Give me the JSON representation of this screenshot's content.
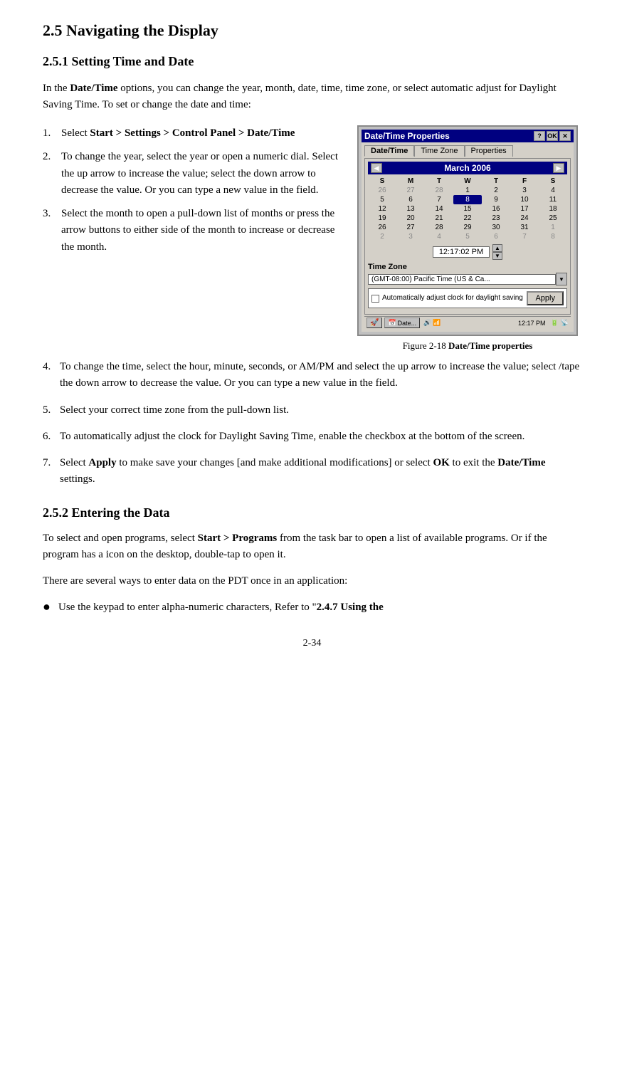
{
  "page": {
    "section_title": "2.5 Navigating the Display",
    "subsection_1_title": "2.5.1 Setting Time and Date",
    "subsection_2_title": "2.5.2 Entering the Data",
    "intro_text_1": "In the ",
    "intro_bold": "Date/Time",
    "intro_text_2": " options, you can change the year, month, date, time, time zone, or select automatic adjust for Daylight Saving Time. To set or change the date and time:",
    "steps": [
      {
        "num": "1.",
        "text": "Select ",
        "bold": "Start > Settings > Control Panel > Date/Time"
      },
      {
        "num": "2.",
        "text": "To change the year, select the year or open a numeric dial. Select the up arrow to increase the value; select the down arrow to decrease the value. Or you can type a new value in the field."
      },
      {
        "num": "3.",
        "text": "Select the month to open a pull-down list of months or press the arrow buttons to either side of the month to increase or decrease the month."
      }
    ],
    "para_steps": [
      {
        "num": "4.",
        "text": "To change the time, select the hour, minute, seconds, or AM/PM and select the up arrow to increase the value; select /tape the down arrow to decrease the value. Or you can type a new value in the field."
      },
      {
        "num": "5.",
        "text": "Select your correct time zone from the pull-down list."
      },
      {
        "num": "6.",
        "text": "To automatically adjust the clock for Daylight Saving Time, enable the checkbox at the bottom of the screen."
      },
      {
        "num": "7.",
        "text_before": "Select ",
        "bold1": "Apply",
        "text_mid": " to make save your changes [and make additional modifications] or select ",
        "bold2": "OK",
        "text_after": " to exit the ",
        "bold3": "Date/Time",
        "text_end": " settings."
      }
    ],
    "section2_para1_1": "To select and open programs, select ",
    "section2_bold1": "Start > Programs",
    "section2_para1_2": " from the task bar to open a list of available programs. Or if the program has a icon on the desktop, double-tap to open it.",
    "section2_para2": "There are several ways to enter data on the PDT once in an application:",
    "bullet_items": [
      {
        "text_before": "Use the keypad to enter alpha-numeric characters, Refer to “",
        "bold": "2.4.7 Using the"
      }
    ],
    "page_number": "2-34",
    "figure_caption_prefix": "Figure 2-18 ",
    "figure_caption_bold": "Date/Time properties",
    "device": {
      "titlebar": "Date/Time Properties",
      "titlebar_question": "?",
      "titlebar_ok": "OK",
      "titlebar_x": "✕",
      "tab1": "Date/Time",
      "tab2": "Time Zone",
      "tab3": "Properties",
      "cal_month_year": "March 2006",
      "cal_days_header": [
        "S",
        "M",
        "T",
        "W",
        "T",
        "F",
        "S"
      ],
      "cal_weeks": [
        [
          "26",
          "27",
          "28",
          "1",
          "2",
          "3",
          "4"
        ],
        [
          "5",
          "6",
          "7",
          "8",
          "9",
          "10",
          "11"
        ],
        [
          "12",
          "13",
          "14",
          "15",
          "16",
          "17",
          "18"
        ],
        [
          "19",
          "20",
          "21",
          "22",
          "23",
          "24",
          "25"
        ],
        [
          "26",
          "27",
          "28",
          "29",
          "30",
          "31",
          "1"
        ],
        [
          "2",
          "3",
          "4",
          "5",
          "6",
          "7",
          "8"
        ]
      ],
      "cal_other_month_indices": {
        "row0": [
          0,
          1,
          2
        ],
        "row4": [
          6
        ],
        "row5": [
          0,
          1,
          2,
          3,
          4,
          5,
          6
        ]
      },
      "today_row": 1,
      "today_col": 3,
      "time_value": "12:17:02 PM",
      "tz_label": "Time Zone",
      "tz_value": "(GMT-08:00) Pacific Time (US & Ca...",
      "daylight_text": "Automatically adjust clock for daylight saving",
      "apply_btn": "Apply",
      "taskbar_start_icon": "🚀",
      "taskbar_date_btn": "Date...",
      "taskbar_time": "12:17 PM"
    }
  }
}
